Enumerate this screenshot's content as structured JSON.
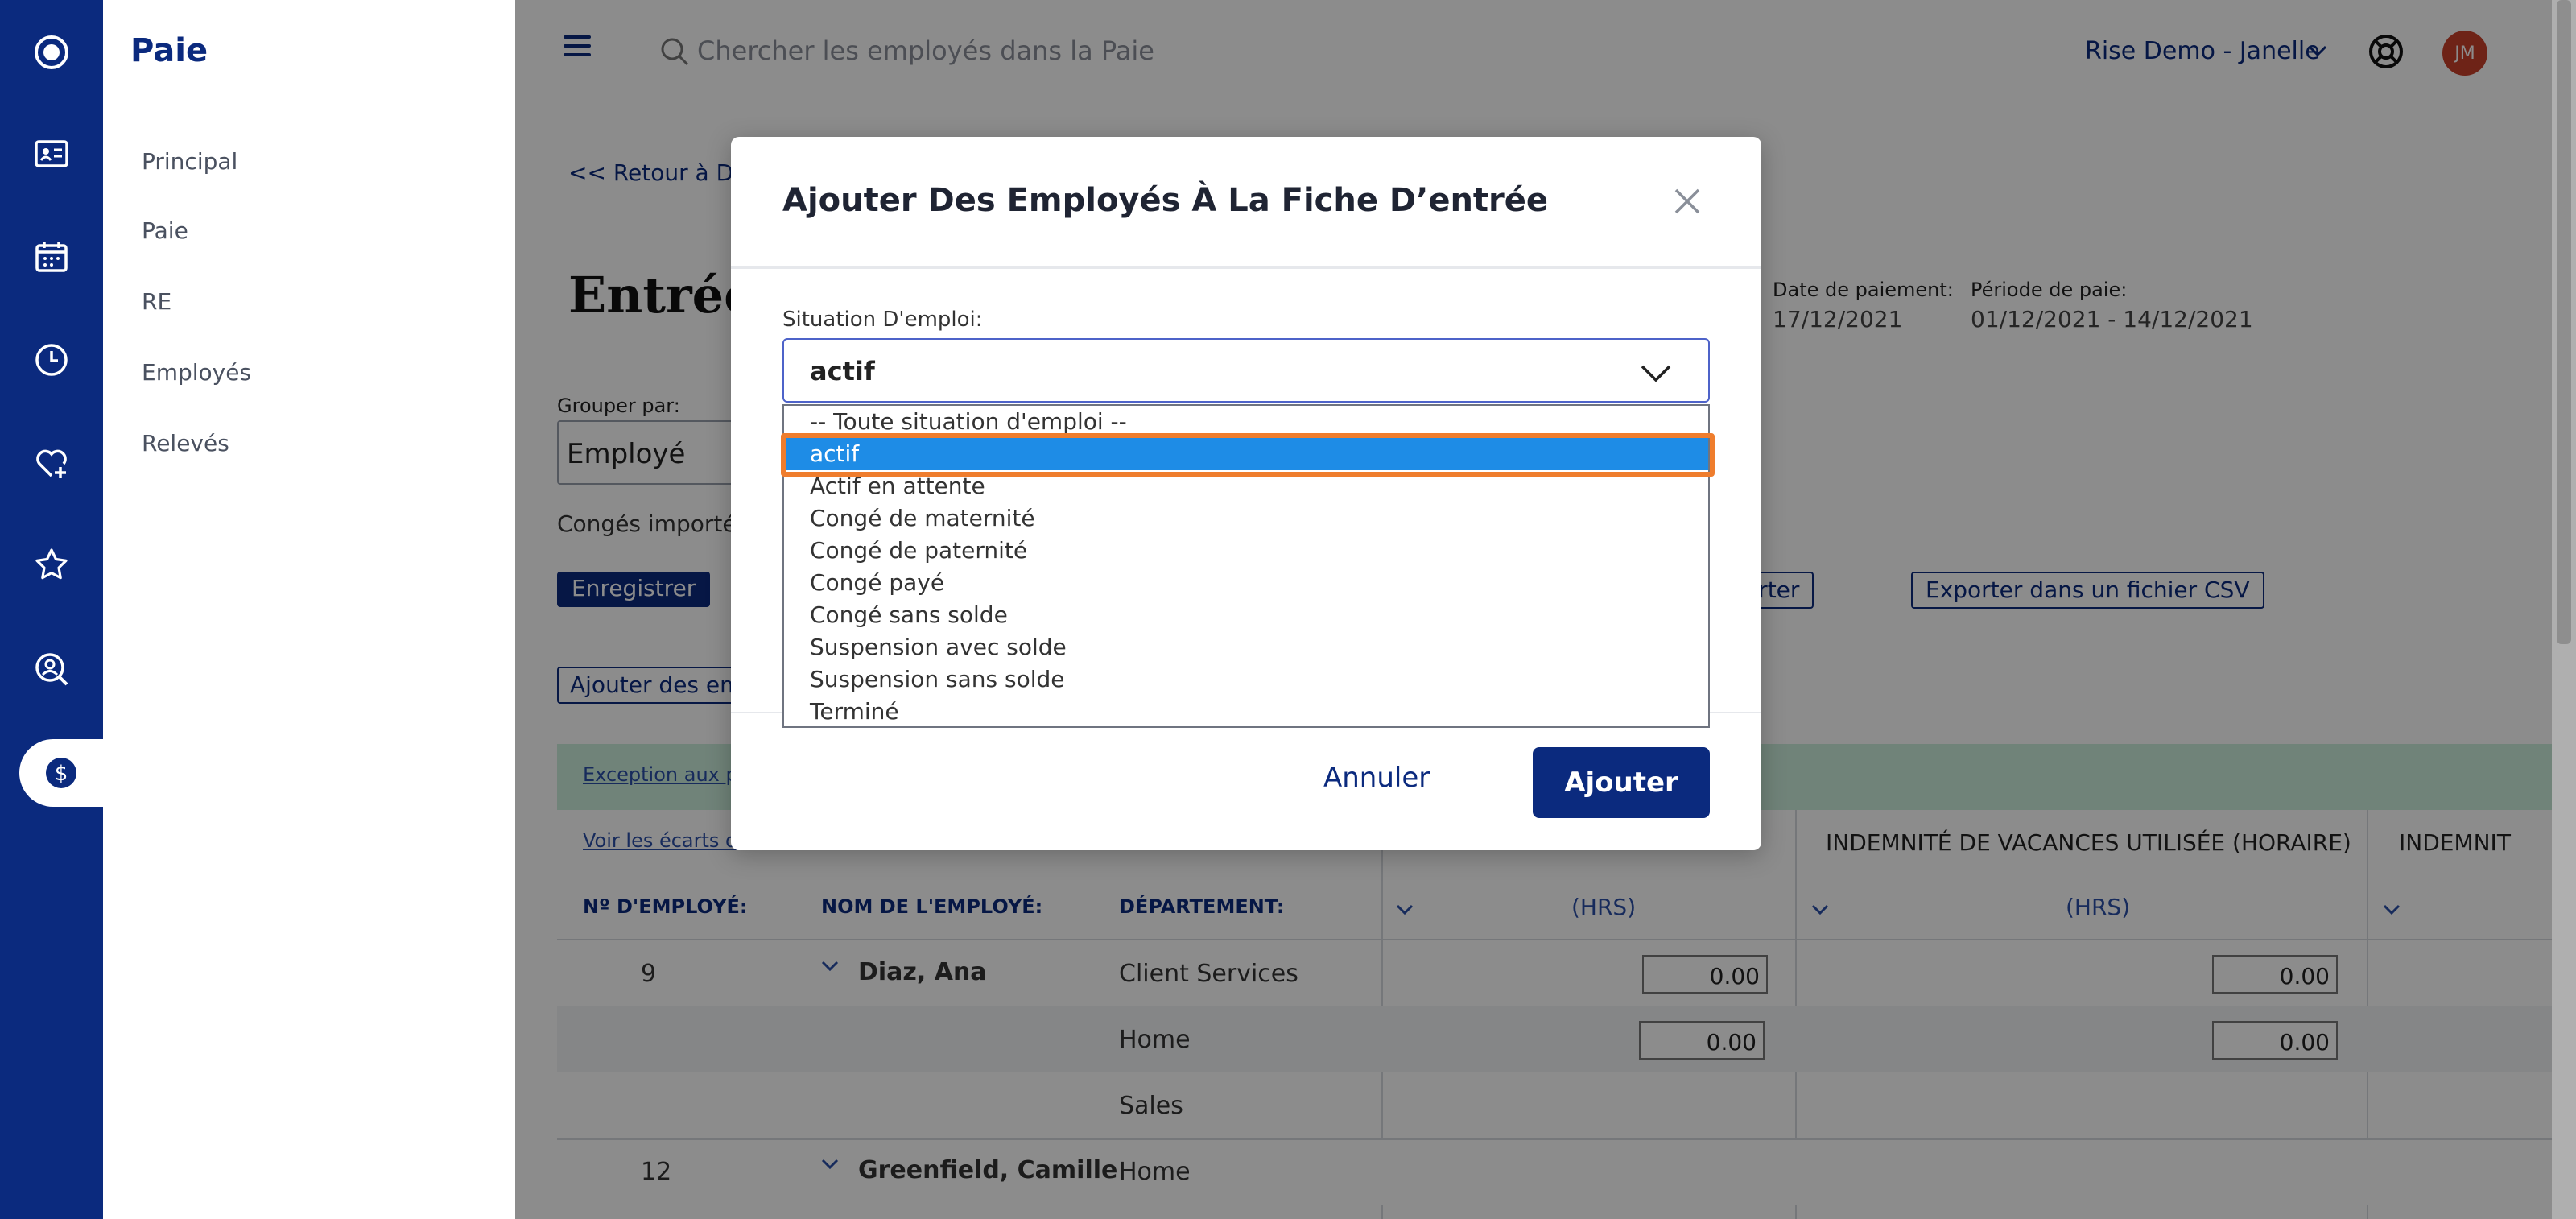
{
  "sidebar": {
    "title": "Paie",
    "items": [
      "Principal",
      "Paie",
      "RE",
      "Employés",
      "Relevés"
    ]
  },
  "topbar": {
    "search_placeholder": "Chercher les employés dans la Paie",
    "company": "Rise Demo - Janelle",
    "avatar_initials": "JM"
  },
  "page": {
    "back_link": "<< Retour à Dér",
    "title": "Entrée",
    "pay_date_label": "Date de paiement:",
    "pay_date": "17/12/2021",
    "pay_period_label": "Période de paie:",
    "pay_period": "01/12/2021 - 14/12/2021",
    "group_label": "Grouper par:",
    "group_value": "Employé",
    "leave_text": "Congés importés",
    "save_button": "Enregistrer",
    "import_button": "mporter",
    "export_button": "Exporter dans un fichier CSV",
    "add_employees_button": "Ajouter des em",
    "exception_link": "Exception aux p",
    "view_link": "Voir les écarts d",
    "col_vacation_used": "INDEMNITÉ DE VACANCES UTILISÉE (HORAIRE)",
    "col_next": "INDEMNIT",
    "th_emp_no": "Nº D'EMPLOYÉ:",
    "th_emp_name": "NOM DE L'EMPLOYÉ:",
    "th_dept": "DÉPARTEMENT:",
    "hrs": "(HRS)"
  },
  "table": {
    "rows": [
      {
        "no": "9",
        "name": "Diaz, Ana",
        "dept": "Client Services",
        "v1": "0.00",
        "v2": "0.00"
      },
      {
        "no": "",
        "name": "",
        "dept": "Home",
        "v1": "0.00",
        "v2": "0.00"
      },
      {
        "no": "",
        "name": "",
        "dept": "Sales",
        "v1": "",
        "v2": ""
      },
      {
        "no": "12",
        "name": "Greenfield, Camille",
        "dept": "Home",
        "v1": "",
        "v2": ""
      }
    ]
  },
  "modal": {
    "title": "Ajouter Des Employés À La Fiche D’entrée",
    "field_label": "Situation D'emploi:",
    "selected_value": "actif",
    "options": [
      "-- Toute situation d'emploi --",
      "actif",
      "Actif en attente",
      "Congé de maternité",
      "Congé de paternité",
      "Congé payé",
      "Congé sans solde",
      "Suspension avec solde",
      "Suspension sans solde",
      "Terminé"
    ],
    "cancel_button": "Annuler",
    "add_button": "Ajouter"
  },
  "colors": {
    "primary": "#0b2a7e",
    "selected_option": "#1e8ce6",
    "highlight": "#ef7d2d",
    "avatar": "#c9402a"
  }
}
